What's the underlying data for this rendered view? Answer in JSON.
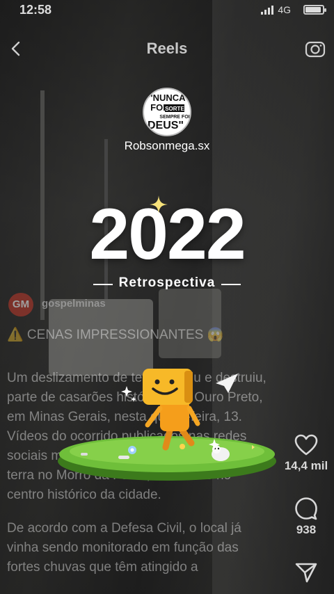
{
  "status": {
    "time": "12:58",
    "network": "4G",
    "signal_bars": 4,
    "battery_level": 0.85
  },
  "header": {
    "title": "Reels",
    "back_icon": "chevron-left-icon",
    "camera_icon": "camera-icon"
  },
  "profile": {
    "logo_text": {
      "line1": "\"NUNCA",
      "line2": "FOI",
      "line2b": "SORTE",
      "line3": "SEMPRE FOI",
      "line4": "DEUS\""
    },
    "username": "Robsonmega.sx"
  },
  "overlay": {
    "year": "2022",
    "subtitle": "Retrospectiva"
  },
  "post": {
    "avatar_text": "GM",
    "account": "gospelminas",
    "headline": "⚠️ CENAS IMPRESSIONANTES 😱",
    "paragraph1": "Um deslizamento de terra atingiu e destruiu, parte de casarões históricos de Ouro Preto, em Minas Gerais, nesta quinta-feira, 13. Vídeos do ocorrido publicados nas redes sociais mostram a força do deslizamento de terra no Morro da Forca, localizado no centro histórico da cidade.",
    "paragraph2": "De acordo com a Defesa Civil, o local já vinha sendo monitorado em função das fortes chuvas que têm atingido a"
  },
  "rail": {
    "likes": "14,4 mil",
    "comments": "938",
    "like_icon": "heart-icon",
    "comment_icon": "comment-icon",
    "share_icon": "send-icon"
  }
}
